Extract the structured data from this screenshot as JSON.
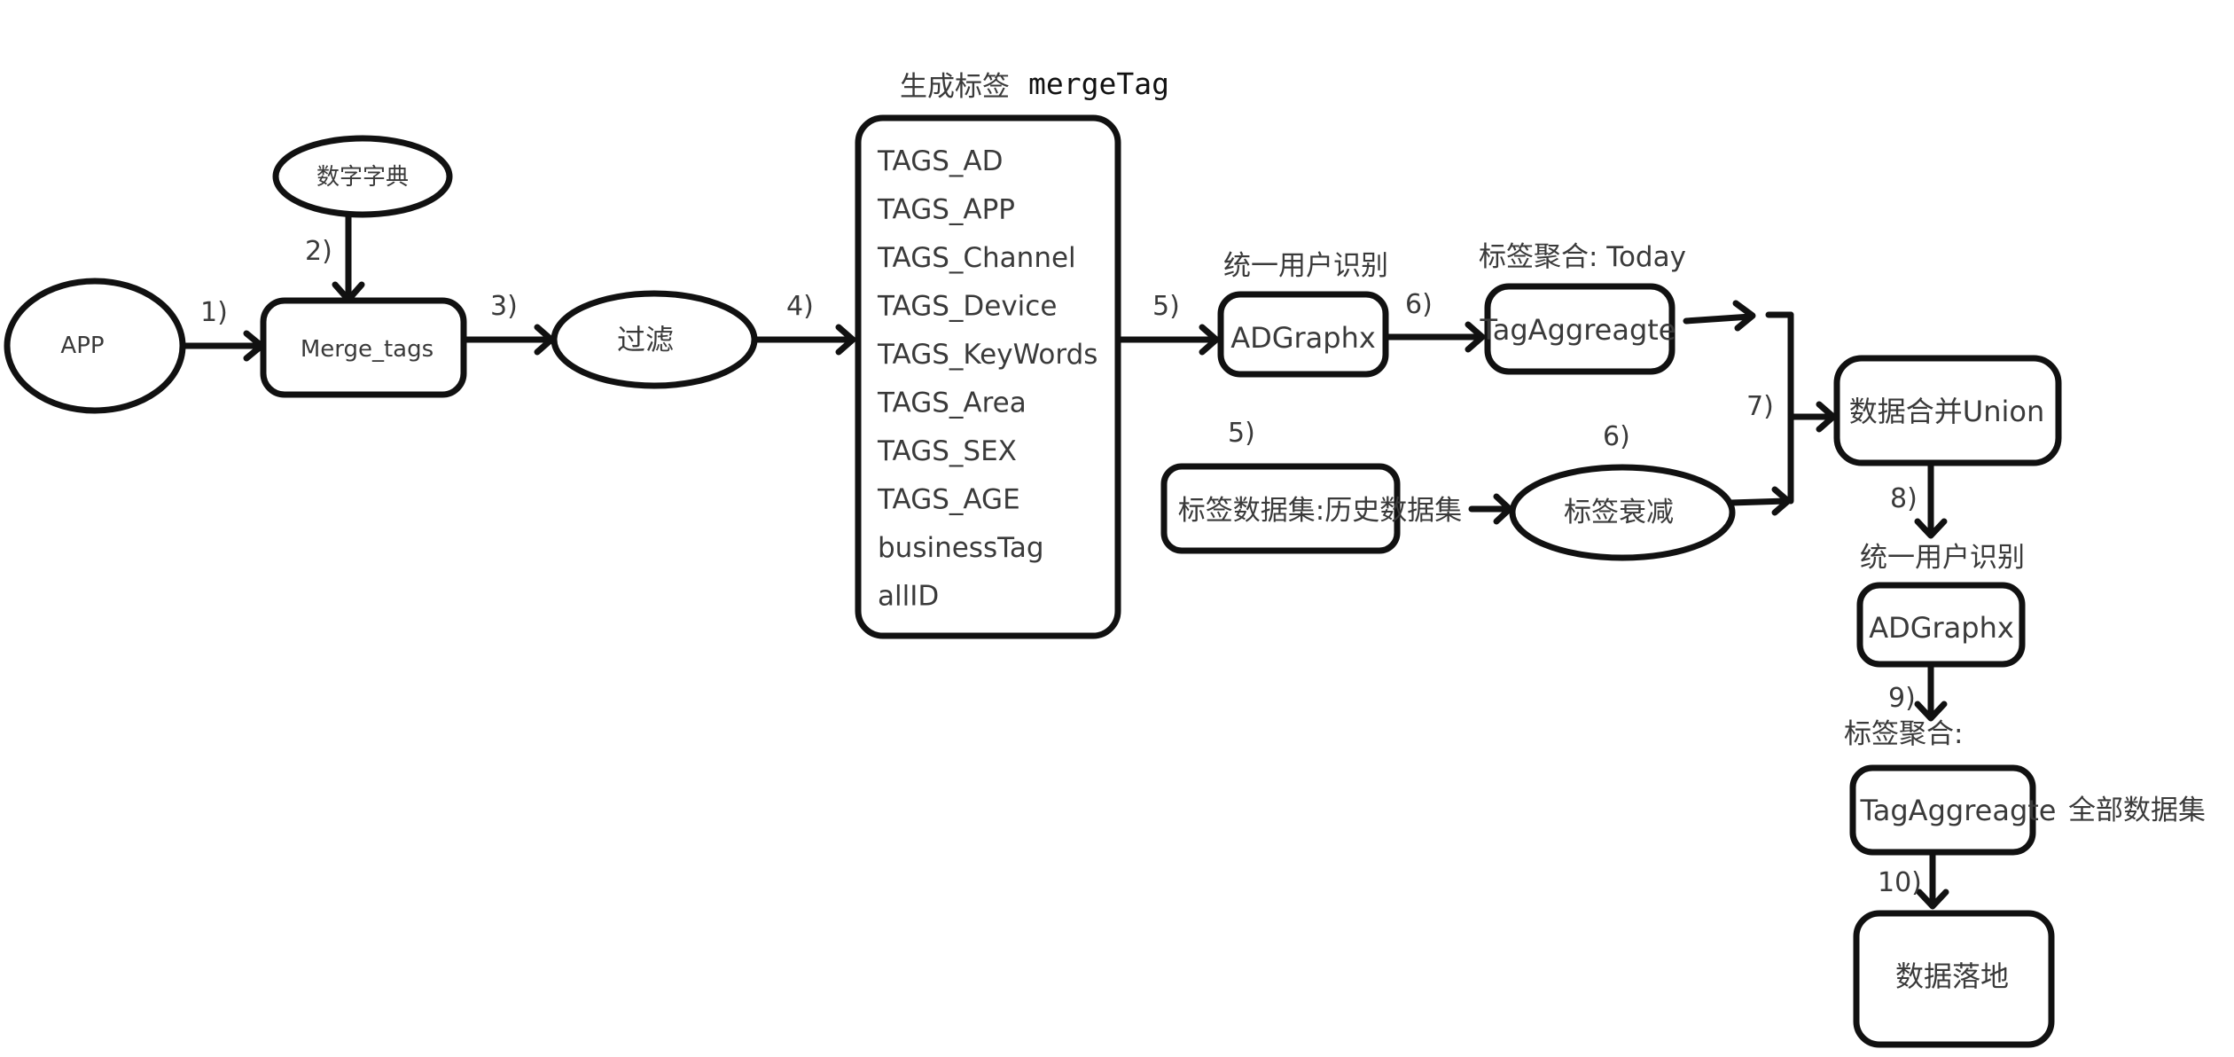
{
  "nodes": {
    "app": "APP",
    "dict": "数字字典",
    "merge_tags": "Merge_tags",
    "filter": "过滤",
    "adgraphx_1": "ADGraphx",
    "tag_aggregate_1": "TagAggreagte",
    "history_dataset": "标签数据集:历史数据集",
    "tag_decay": "标签衰减",
    "union": "数据合并Union",
    "adgraphx_2": "ADGraphx",
    "tag_aggregate_2": "TagAggreagte",
    "landing": "数据落地"
  },
  "merge_tag_box": {
    "title_cn": "生成标签",
    "title_code": "mergeTag",
    "items": [
      "TAGS_AD",
      "TAGS_APP",
      "TAGS_Channel",
      "TAGS_Device",
      "TAGS_KeyWords",
      "TAGS_Area",
      "TAGS_SEX",
      "TAGS_AGE",
      "businessTag",
      "allID"
    ]
  },
  "captions": {
    "user_id_1": "统一用户识别",
    "tag_agg_today": "标签聚合: Today",
    "user_id_2": "统一用户识别",
    "tag_agg_2": "标签聚合:",
    "all_dataset": "全部数据集"
  },
  "steps": {
    "s1": "1)",
    "s2": "2)",
    "s3": "3)",
    "s4": "4)",
    "s5a": "5)",
    "s5b": "5)",
    "s6a": "6)",
    "s6b": "6)",
    "s7": "7)",
    "s8": "8)",
    "s9": "9)",
    "s10": "10)"
  }
}
